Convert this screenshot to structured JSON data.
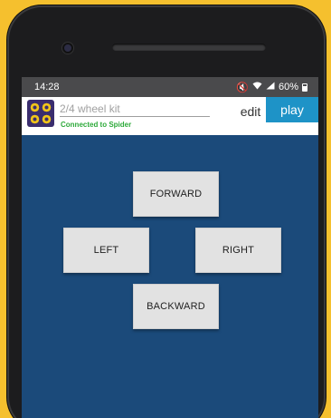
{
  "status_bar": {
    "time": "14:28",
    "battery": "60%",
    "icons": [
      "mute-icon",
      "wifi-icon",
      "signal-icon",
      "battery-icon"
    ]
  },
  "app_bar": {
    "icon": "wheel-kit-icon",
    "kit_input": {
      "value": "",
      "placeholder": "2/4 wheel kit"
    },
    "connection_status": "Connected to Spider",
    "edit_label": "edit",
    "play_label": "play"
  },
  "controls": {
    "forward": "FORWARD",
    "left": "LEFT",
    "right": "RIGHT",
    "backward": "BACKWARD"
  },
  "colors": {
    "background": "#f5c02e",
    "screen": "#1b4a7a",
    "play_button": "#1e93c7",
    "connected_text": "#2eaa3b"
  }
}
